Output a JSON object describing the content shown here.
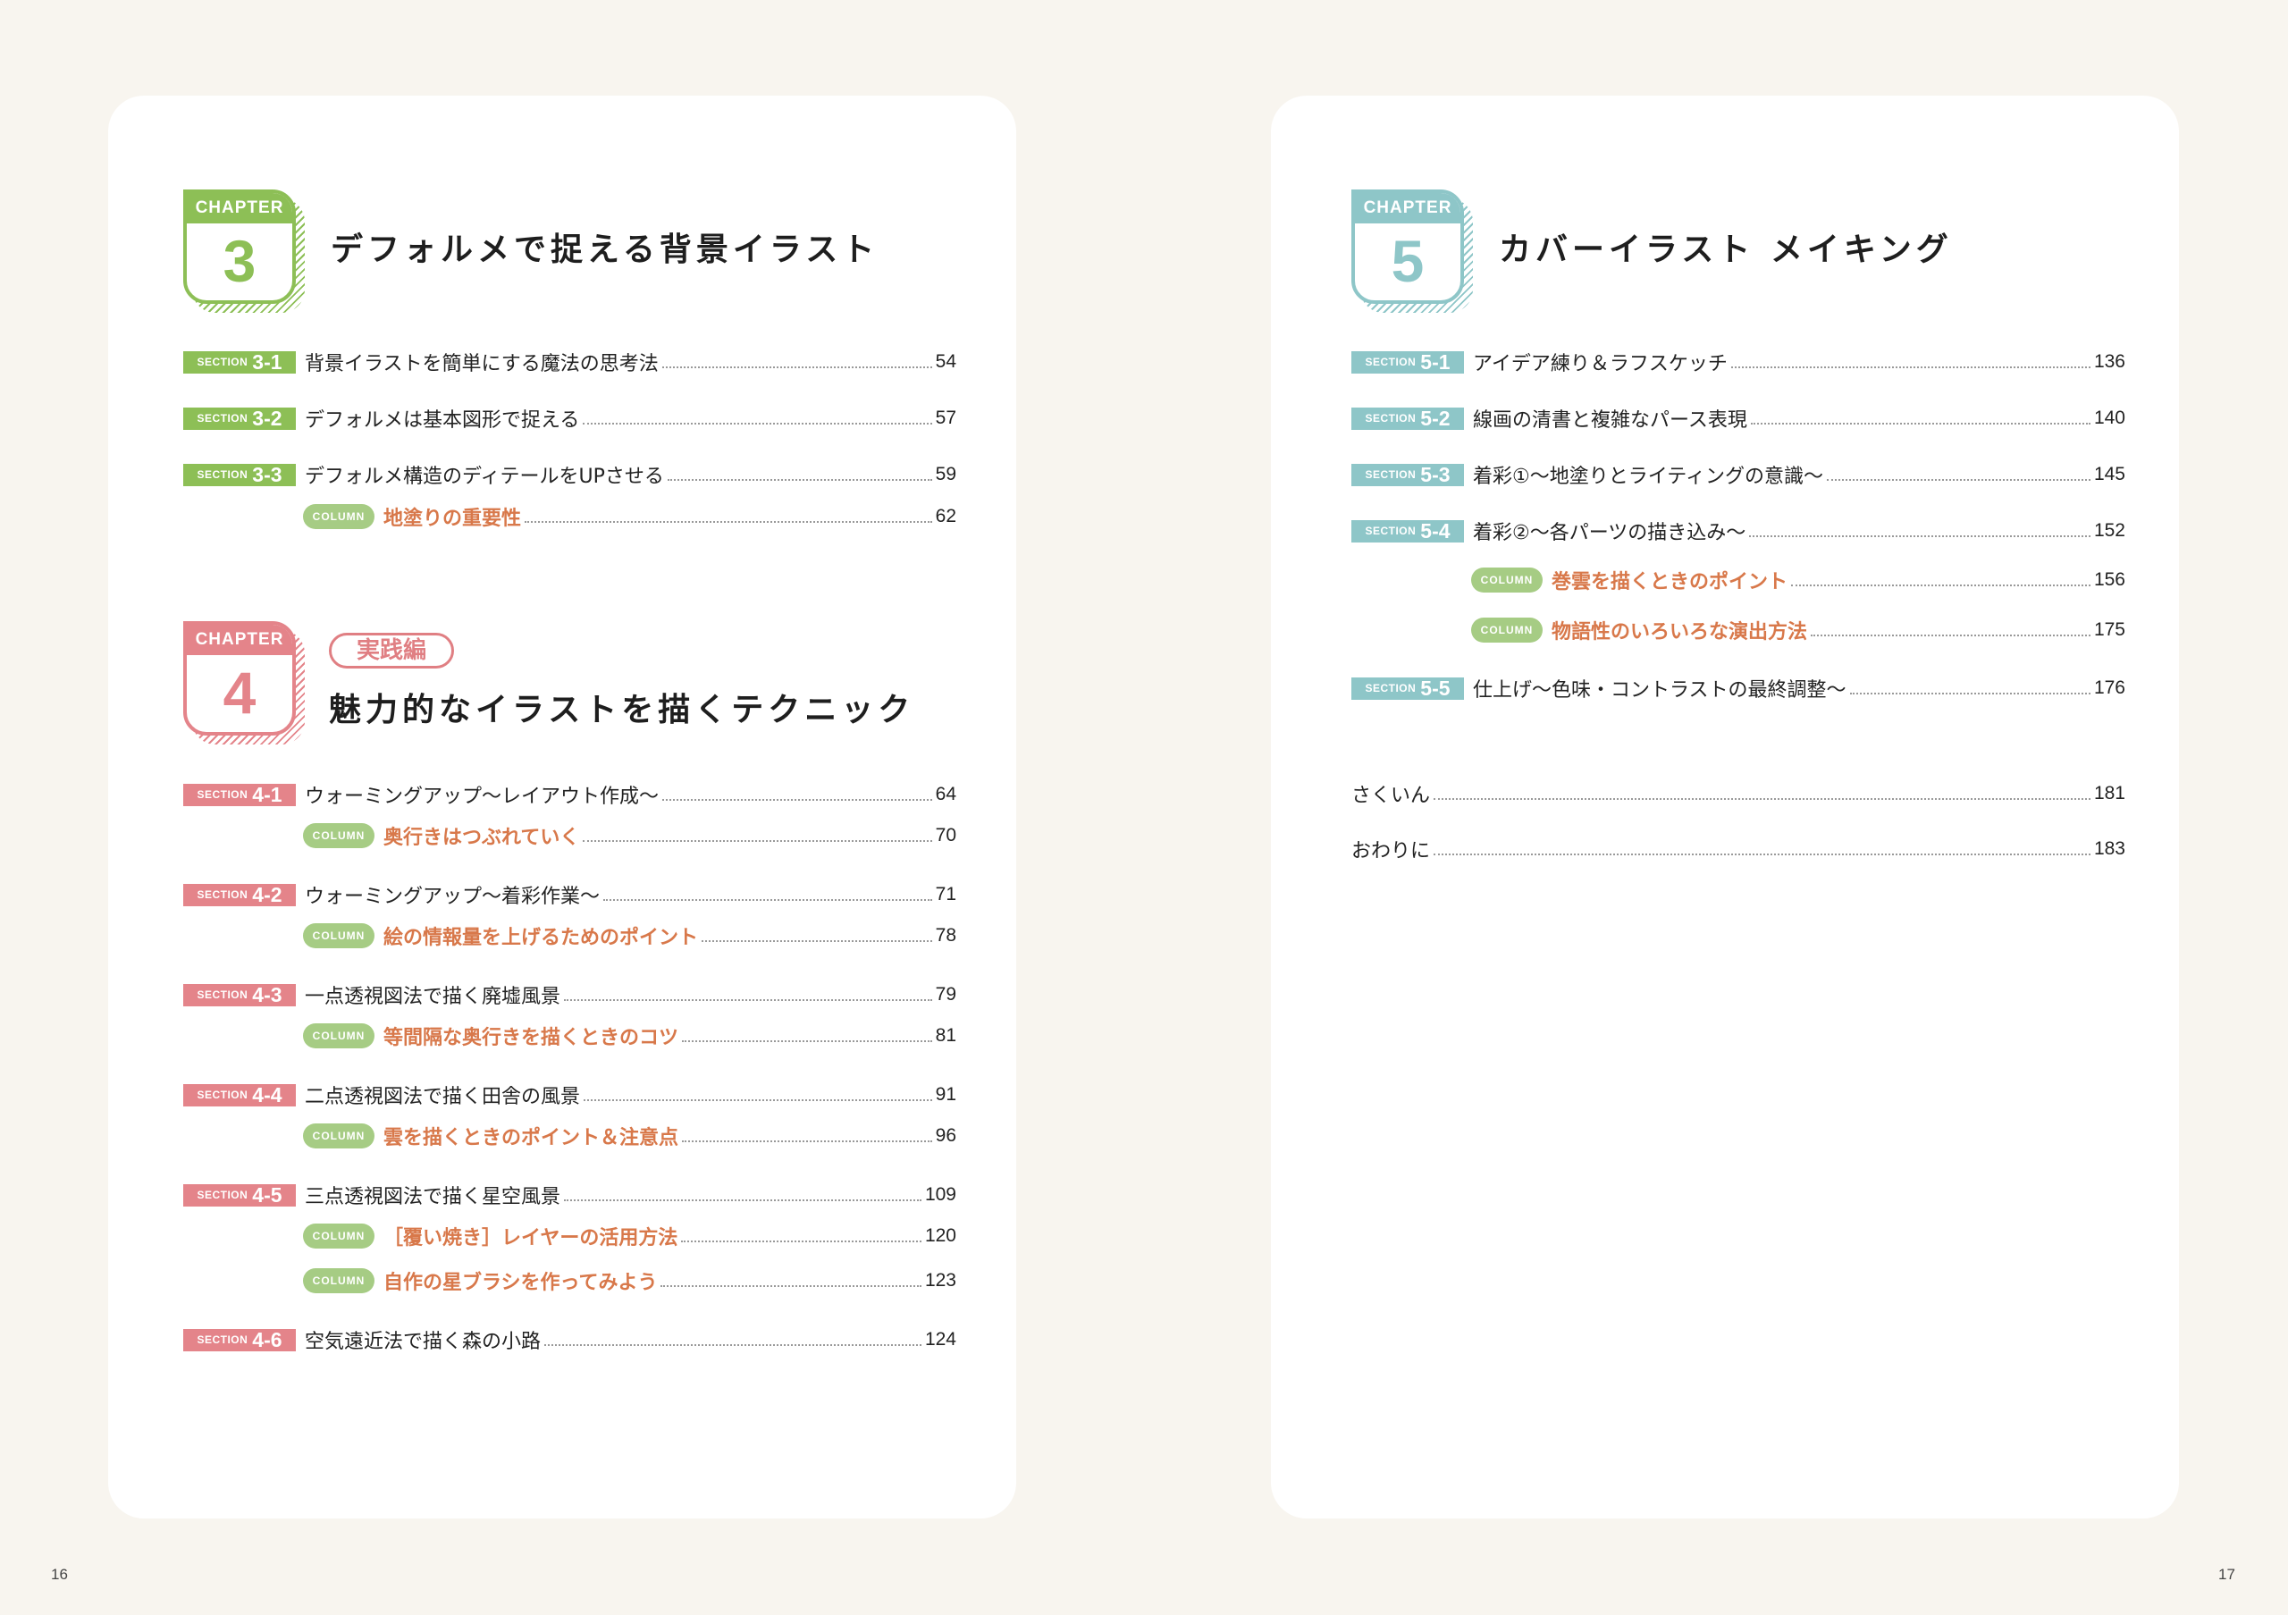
{
  "left": {
    "chapter3": {
      "chapter_word": "CHAPTER",
      "number": "3",
      "title": "デフォルメで捉える背景イラスト",
      "sections": [
        {
          "word": "SECTION",
          "num": "3-1",
          "title": "背景イラストを簡単にする魔法の思考法",
          "page": "54"
        },
        {
          "word": "SECTION",
          "num": "3-2",
          "title": "デフォルメは基本図形で捉える",
          "page": "57"
        },
        {
          "word": "SECTION",
          "num": "3-3",
          "title": "デフォルメ構造のディテールをUPさせる",
          "page": "59"
        }
      ],
      "columns": [
        {
          "word": "COLUMN",
          "title": "地塗りの重要性",
          "page": "62"
        }
      ]
    },
    "chapter4": {
      "chapter_word": "CHAPTER",
      "number": "4",
      "tag": "実践編",
      "title": "魅力的なイラストを描くテクニック",
      "sections": [
        {
          "word": "SECTION",
          "num": "4-1",
          "title": "ウォーミングアップ〜レイアウト作成〜",
          "page": "64"
        },
        {
          "word": "SECTION",
          "num": "4-2",
          "title": "ウォーミングアップ〜着彩作業〜",
          "page": "71"
        },
        {
          "word": "SECTION",
          "num": "4-3",
          "title": "一点透視図法で描く廃墟風景",
          "page": "79"
        },
        {
          "word": "SECTION",
          "num": "4-4",
          "title": "二点透視図法で描く田舎の風景",
          "page": "91"
        },
        {
          "word": "SECTION",
          "num": "4-5",
          "title": "三点透視図法で描く星空風景",
          "page": "109"
        },
        {
          "word": "SECTION",
          "num": "4-6",
          "title": "空気遠近法で描く森の小路",
          "page": "124"
        }
      ],
      "columns": [
        {
          "word": "COLUMN",
          "title": "奥行きはつぶれていく",
          "page": "70"
        },
        {
          "word": "COLUMN",
          "title": "絵の情報量を上げるためのポイント",
          "page": "78"
        },
        {
          "word": "COLUMN",
          "title": "等間隔な奥行きを描くときのコツ",
          "page": "81"
        },
        {
          "word": "COLUMN",
          "title": "雲を描くときのポイント＆注意点",
          "page": "96"
        },
        {
          "word": "COLUMN",
          "title": "［覆い焼き］レイヤーの活用方法",
          "page": "120"
        },
        {
          "word": "COLUMN",
          "title": "自作の星ブラシを作ってみよう",
          "page": "123"
        }
      ]
    },
    "folio": "16"
  },
  "right": {
    "chapter5": {
      "chapter_word": "CHAPTER",
      "number": "5",
      "title": "カバーイラスト メイキング",
      "sections": [
        {
          "word": "SECTION",
          "num": "5-1",
          "title": "アイデア練り＆ラフスケッチ",
          "page": "136"
        },
        {
          "word": "SECTION",
          "num": "5-2",
          "title": "線画の清書と複雑なパース表現",
          "page": "140"
        },
        {
          "word": "SECTION",
          "num": "5-3",
          "title": "着彩①〜地塗りとライティングの意識〜",
          "page": "145"
        },
        {
          "word": "SECTION",
          "num": "5-4",
          "title": "着彩②〜各パーツの描き込み〜",
          "page": "152"
        },
        {
          "word": "SECTION",
          "num": "5-5",
          "title": "仕上げ〜色味・コントラストの最終調整〜",
          "page": "176"
        }
      ],
      "columns": [
        {
          "word": "COLUMN",
          "title": "巻雲を描くときのポイント",
          "page": "156"
        },
        {
          "word": "COLUMN",
          "title": "物語性のいろいろな演出方法",
          "page": "175"
        }
      ]
    },
    "extras": [
      {
        "title": "さくいん",
        "page": "181"
      },
      {
        "title": "おわりに",
        "page": "183"
      }
    ],
    "folio": "17"
  }
}
